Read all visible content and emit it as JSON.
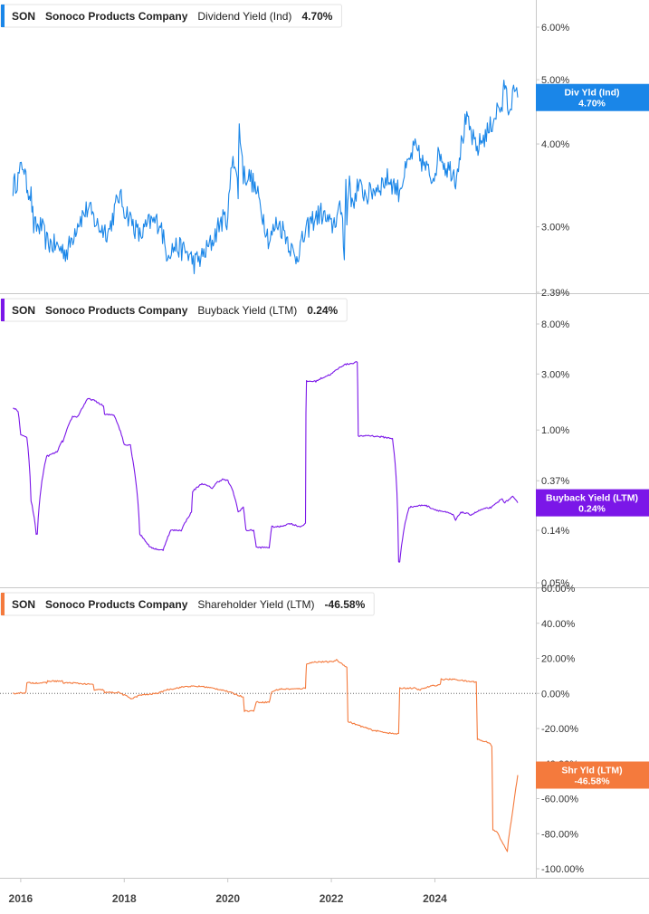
{
  "chart_data": [
    {
      "type": "line",
      "ticker": "SON",
      "company": "Sonoco Products Company",
      "metric": "Dividend Yield (Ind)",
      "last_value": "4.70%",
      "tag_line1": "Div Yld (Ind)",
      "tag_line2": "4.70%",
      "color": "#1a86e8",
      "scale": "log",
      "ylim": [
        2.39,
        6.6
      ],
      "yticks": [
        {
          "v": 6.0,
          "label": "6.00%"
        },
        {
          "v": 5.0,
          "label": "5.00%"
        },
        {
          "v": 4.0,
          "label": "4.00%"
        },
        {
          "v": 3.0,
          "label": "3.00%"
        },
        {
          "v": 2.39,
          "label": "2.39%"
        }
      ],
      "noise": 0.04,
      "x": [
        2015.85,
        2015.95,
        2016.05,
        2016.1,
        2016.2,
        2016.25,
        2016.4,
        2016.5,
        2016.7,
        2016.9,
        2017.1,
        2017.3,
        2017.5,
        2017.7,
        2017.9,
        2018.0,
        2018.15,
        2018.3,
        2018.5,
        2018.7,
        2018.8,
        2019.0,
        2019.2,
        2019.35,
        2019.5,
        2019.7,
        2019.85,
        2020.0,
        2020.1,
        2020.2,
        2020.22,
        2020.3,
        2020.45,
        2020.6,
        2020.8,
        2020.95,
        2021.1,
        2021.3,
        2021.4,
        2021.6,
        2021.8,
        2022.0,
        2022.2,
        2022.25,
        2022.28,
        2022.3,
        2022.35,
        2022.4,
        2022.5,
        2022.7,
        2022.9,
        2023.1,
        2023.3,
        2023.5,
        2023.6,
        2023.8,
        2023.95,
        2024.1,
        2024.2,
        2024.35,
        2024.4,
        2024.6,
        2024.7,
        2024.8,
        2024.9,
        2025.05,
        2025.2,
        2025.3,
        2025.35,
        2025.42,
        2025.5,
        2025.6
      ],
      "values": [
        3.45,
        3.55,
        3.75,
        3.5,
        3.35,
        3.0,
        3.0,
        2.85,
        2.8,
        2.75,
        3.05,
        3.2,
        3.0,
        2.95,
        3.35,
        3.2,
        3.05,
        2.9,
        3.05,
        3.05,
        2.75,
        2.8,
        2.75,
        2.65,
        2.7,
        2.85,
        3.05,
        3.1,
        3.9,
        3.4,
        4.3,
        3.6,
        3.55,
        3.3,
        2.85,
        3.05,
        2.95,
        2.68,
        2.8,
        3.05,
        3.15,
        3.0,
        3.2,
        2.75,
        3.5,
        3.05,
        3.6,
        3.2,
        3.45,
        3.35,
        3.45,
        3.55,
        3.4,
        3.75,
        3.95,
        3.7,
        3.55,
        3.9,
        3.7,
        3.65,
        3.55,
        4.35,
        4.15,
        3.9,
        4.05,
        4.2,
        4.5,
        4.55,
        4.95,
        4.5,
        4.75,
        4.7
      ]
    },
    {
      "type": "line",
      "ticker": "SON",
      "company": "Sonoco Products Company",
      "metric": "Buyback Yield (LTM)",
      "last_value": "0.24%",
      "tag_line1": "Buyback Yield (LTM)",
      "tag_line2": "0.24%",
      "color": "#7b17e8",
      "scale": "log",
      "ylim": [
        0.05,
        10.0
      ],
      "yticks": [
        {
          "v": 8.0,
          "label": "8.00%"
        },
        {
          "v": 3.0,
          "label": "3.00%"
        },
        {
          "v": 1.0,
          "label": "1.00%"
        },
        {
          "v": 0.37,
          "label": "0.37%"
        },
        {
          "v": 0.14,
          "label": "0.14%"
        },
        {
          "v": 0.05,
          "label": "0.05%"
        }
      ],
      "noise": 0.015,
      "x": [
        2015.85,
        2015.95,
        2016.0,
        2016.1,
        2016.12,
        2016.2,
        2016.3,
        2016.32,
        2016.5,
        2016.52,
        2016.7,
        2016.8,
        2016.82,
        2017.0,
        2017.1,
        2017.12,
        2017.3,
        2017.4,
        2017.6,
        2017.62,
        2017.8,
        2018.0,
        2018.12,
        2018.15,
        2018.3,
        2018.5,
        2018.7,
        2018.75,
        2018.9,
        2019.1,
        2019.3,
        2019.32,
        2019.5,
        2019.7,
        2019.8,
        2019.9,
        2020.0,
        2020.1,
        2020.15,
        2020.2,
        2020.3,
        2020.35,
        2020.5,
        2020.55,
        2020.8,
        2020.85,
        2021.0,
        2021.2,
        2021.4,
        2021.5,
        2021.52,
        2021.7,
        2021.8,
        2022.0,
        2022.2,
        2022.25,
        2022.4,
        2022.5,
        2022.52,
        2022.7,
        2023.0,
        2023.15,
        2023.18,
        2023.3,
        2023.32,
        2023.5,
        2023.8,
        2024.0,
        2024.2,
        2024.35,
        2024.4,
        2024.5,
        2024.7,
        2024.9,
        2025.1,
        2025.3,
        2025.35,
        2025.5,
        2025.6
      ],
      "values": [
        1.55,
        1.45,
        0.9,
        0.88,
        0.85,
        0.25,
        0.13,
        0.13,
        0.6,
        0.6,
        0.65,
        0.8,
        0.8,
        1.3,
        1.3,
        1.35,
        1.85,
        1.8,
        1.6,
        1.35,
        1.35,
        0.75,
        0.75,
        0.6,
        0.13,
        0.1,
        0.095,
        0.095,
        0.14,
        0.14,
        0.2,
        0.3,
        0.35,
        0.32,
        0.36,
        0.38,
        0.37,
        0.3,
        0.25,
        0.2,
        0.22,
        0.14,
        0.14,
        0.1,
        0.1,
        0.15,
        0.15,
        0.16,
        0.15,
        0.16,
        2.6,
        2.6,
        2.75,
        3.0,
        3.5,
        3.6,
        3.7,
        3.8,
        0.88,
        0.9,
        0.87,
        0.85,
        0.85,
        0.075,
        0.075,
        0.22,
        0.23,
        0.21,
        0.2,
        0.19,
        0.17,
        0.2,
        0.19,
        0.21,
        0.22,
        0.26,
        0.24,
        0.27,
        0.24
      ]
    },
    {
      "type": "line",
      "ticker": "SON",
      "company": "Sonoco Products Company",
      "metric": "Shareholder Yield (LTM)",
      "last_value": "-46.58%",
      "tag_line1": "Shr Yld (LTM)",
      "tag_line2": "-46.58%",
      "color": "#f47a3d",
      "scale": "linear",
      "ylim": [
        -100.0,
        60.0
      ],
      "yticks": [
        {
          "v": 60,
          "label": "60.00%"
        },
        {
          "v": 40,
          "label": "40.00%"
        },
        {
          "v": 20,
          "label": "20.00%"
        },
        {
          "v": 0,
          "label": "0.00%"
        },
        {
          "v": -20,
          "label": "-20.00%"
        },
        {
          "v": -40,
          "label": "-40.00%"
        },
        {
          "v": -60,
          "label": "-60.00%"
        },
        {
          "v": -80,
          "label": "-80.00%"
        },
        {
          "v": -100,
          "label": "-100.00%"
        }
      ],
      "zero_line": true,
      "noise": 0.4,
      "x": [
        2015.85,
        2016.1,
        2016.12,
        2016.5,
        2016.52,
        2016.8,
        2016.82,
        2017.0,
        2017.4,
        2017.42,
        2017.6,
        2017.62,
        2017.9,
        2018.0,
        2018.15,
        2018.3,
        2018.5,
        2018.7,
        2018.8,
        2019.0,
        2019.2,
        2019.5,
        2019.7,
        2019.9,
        2020.0,
        2020.1,
        2020.3,
        2020.32,
        2020.5,
        2020.55,
        2020.8,
        2020.85,
        2021.0,
        2021.3,
        2021.5,
        2021.52,
        2021.7,
        2022.0,
        2022.1,
        2022.3,
        2022.32,
        2022.5,
        2022.7,
        2022.8,
        2023.0,
        2023.2,
        2023.3,
        2023.32,
        2023.6,
        2023.7,
        2023.9,
        2024.1,
        2024.12,
        2024.4,
        2024.6,
        2024.8,
        2024.82,
        2024.9,
        2025.05,
        2025.1,
        2025.12,
        2025.2,
        2025.3,
        2025.4,
        2025.42,
        2025.6
      ],
      "values": [
        0,
        0.5,
        6,
        6,
        7,
        7,
        6,
        6,
        5,
        2,
        2,
        0.5,
        0.5,
        -1,
        -3,
        -1,
        -0.5,
        0.5,
        2,
        3,
        4,
        4,
        3,
        2,
        1,
        0,
        -2,
        -10,
        -10,
        -5,
        -5,
        1,
        2.5,
        2.5,
        3,
        17,
        18,
        18,
        19,
        15,
        -16,
        -18,
        -20,
        -21,
        -22,
        -23,
        -23,
        3,
        3,
        2,
        4,
        5,
        8,
        8,
        7,
        6.5,
        -26,
        -27,
        -28,
        -30,
        -78,
        -79,
        -85,
        -90,
        -84,
        -46.58
      ]
    }
  ],
  "x_axis": {
    "ticks": [
      {
        "v": 2016,
        "label": "2016"
      },
      {
        "v": 2018,
        "label": "2018"
      },
      {
        "v": 2020,
        "label": "2020"
      },
      {
        "v": 2022,
        "label": "2022"
      },
      {
        "v": 2024,
        "label": "2024"
      }
    ],
    "xlim": [
      2015.6,
      2025.95
    ]
  }
}
